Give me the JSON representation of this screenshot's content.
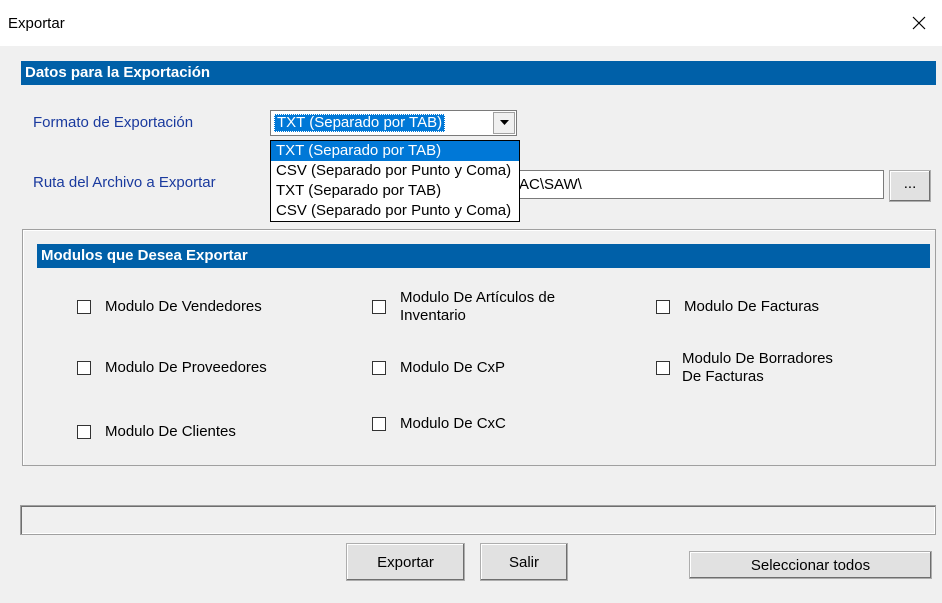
{
  "window": {
    "title": "Exportar"
  },
  "export_data": {
    "header": "Datos para la Exportación",
    "format_label": "Formato de Exportación",
    "format_value": "TXT (Separado por TAB)",
    "format_options": [
      "TXT (Separado por TAB)",
      "CSV (Separado por Punto y Coma)",
      "TXT (Separado por TAB)",
      "CSV (Separado por Punto y Coma)"
    ],
    "path_label": "Ruta del Archivo a Exportar",
    "path_value": "AC\\SAW\\",
    "browse_label": "..."
  },
  "modules": {
    "header": "Modulos que Desea Exportar",
    "items": [
      {
        "label": "Modulo De Vendedores",
        "checked": false
      },
      {
        "label": "Modulo De Artículos de Inventario",
        "checked": false
      },
      {
        "label": "Modulo De Facturas",
        "checked": false
      },
      {
        "label": "Modulo De Proveedores",
        "checked": false
      },
      {
        "label": "Modulo De CxP",
        "checked": false
      },
      {
        "label": "Modulo De Borradores De Facturas",
        "checked": false
      },
      {
        "label": "Modulo De Clientes",
        "checked": false
      },
      {
        "label": "Modulo De CxC",
        "checked": false
      }
    ]
  },
  "buttons": {
    "export": "Exportar",
    "exit": "Salir",
    "select_all": "Seleccionar todos"
  }
}
